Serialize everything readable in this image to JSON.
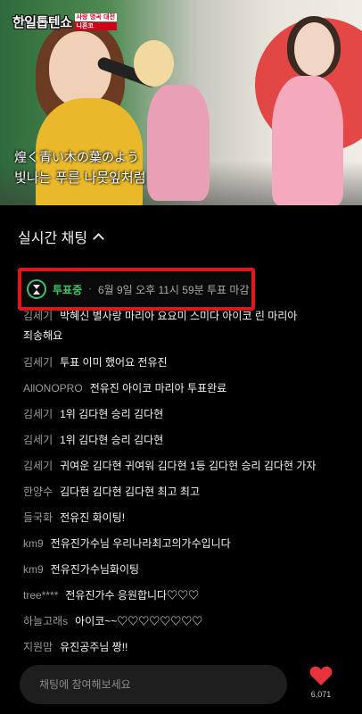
{
  "video": {
    "logo_main": "한일톱텐쇼",
    "logo_sub1": "사랑 명곡 대전",
    "logo_sub2": "니혼코",
    "subtitle_jp": "煌く青い木の葉のよう",
    "subtitle_kr": "빛나는 푸른 나뭇잎처럼"
  },
  "chat": {
    "title": "실시간 채팅",
    "vote": {
      "status": "투표중",
      "separator": "·",
      "deadline": "6월 9일 오후 11시 59분 투표 마감"
    },
    "messages": [
      {
        "nick": "김세기",
        "text": "박혜신 별사랑 마리아 요요미 스미다 아이코 린 마리아"
      },
      {
        "nick": "",
        "text": "죄송해요"
      },
      {
        "nick": "김세기",
        "text": "투표 이미 했어요 전유진"
      },
      {
        "nick": "AllONOPRO",
        "text": "전유진 아이코 마리아 투표완료"
      },
      {
        "nick": "김세기",
        "text": "1위 김다현 승리 김다현"
      },
      {
        "nick": "김세기",
        "text": "1위 김다현 승리 김다현"
      },
      {
        "nick": "김세기",
        "text": "귀여운 김다현 귀여워 김다현 1등 김다현 승리 김다현 가자"
      },
      {
        "nick": "한양수",
        "text": "김다현 김다현 김다현 최고 최고"
      },
      {
        "nick": "들국화",
        "text": "전유진 화이팅!"
      },
      {
        "nick": "km9",
        "text": "전유진가수님 우리나라최고의가수입니다"
      },
      {
        "nick": "km9",
        "text": "전유진가수님화이팅"
      },
      {
        "nick": "tree****",
        "text": "전유진가수 응원합니다♡♡♡"
      },
      {
        "nick": "하늘고래s",
        "text": "아이코~~♡♡♡♡♡♡♡♡"
      },
      {
        "nick": "지원맘",
        "text": "유진공주님 짱!!"
      }
    ],
    "input_placeholder": "채팅에 참여해보세요",
    "like_count": "6,071"
  },
  "colors": {
    "accent_green": "#38c76a",
    "highlight_red": "#e3141b",
    "heart_red": "#e8323c"
  },
  "icons": [
    "hourglass-icon",
    "chevron-up-icon",
    "heart-icon"
  ]
}
